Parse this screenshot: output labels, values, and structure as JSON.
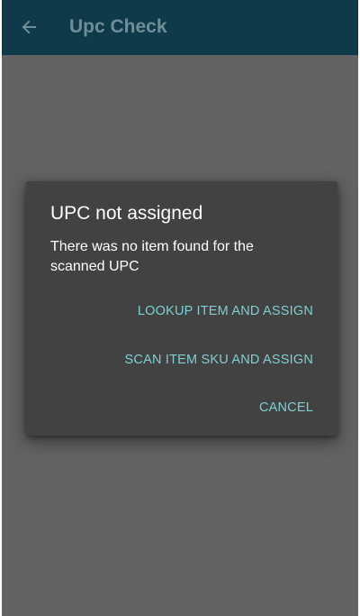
{
  "app_bar": {
    "title": "Upc Check",
    "back_icon": "arrow-left-icon",
    "background_color": "#0e3a4a"
  },
  "overlay_color": "#626262",
  "dialog": {
    "title": "UPC not assigned",
    "message": "There was no item found for the scanned UPC",
    "actions": {
      "lookup": "LOOKUP ITEM AND ASSIGN",
      "scan_sku": "SCAN ITEM SKU AND ASSIGN",
      "cancel": "CANCEL"
    },
    "background_color": "#424242",
    "accent_color": "#7fcfd2"
  }
}
